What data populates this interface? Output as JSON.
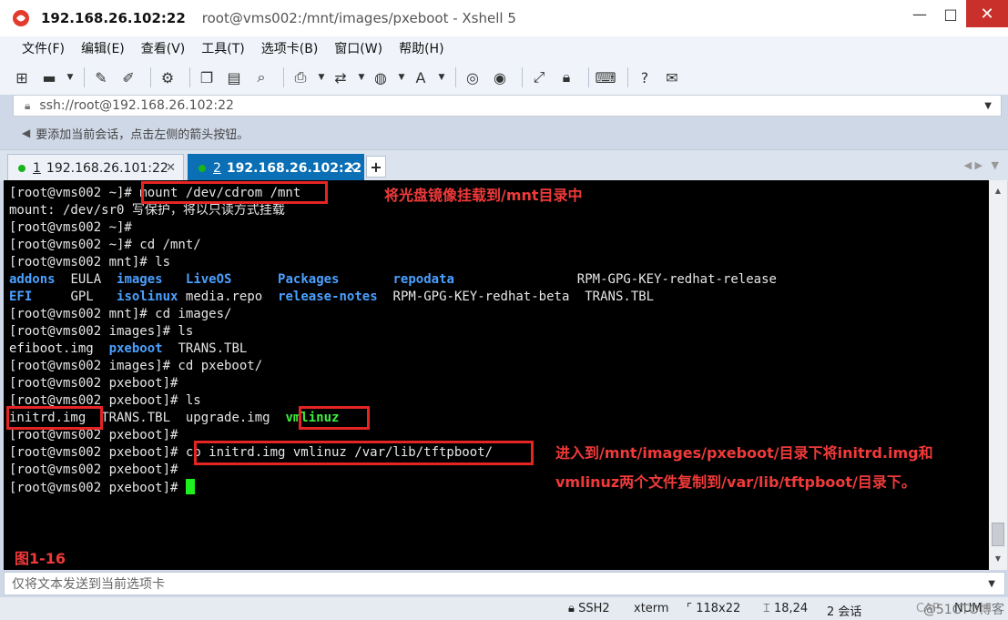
{
  "window": {
    "title_ip": "192.168.26.102:22",
    "title_path": "root@vms002:/mnt/images/pxeboot - Xshell 5",
    "minimize": "—",
    "maximize": "□",
    "close": "✕"
  },
  "menu": [
    "文件(F)",
    "编辑(E)",
    "查看(V)",
    "工具(T)",
    "选项卡(B)",
    "窗口(W)",
    "帮助(H)"
  ],
  "address": {
    "value": "ssh://root@192.168.26.102:22"
  },
  "hint": "要添加当前会话，点击左侧的箭头按钮。",
  "tabs": [
    {
      "num": "1",
      "label": "192.168.26.101:22",
      "status_color": "#18b418"
    },
    {
      "num": "2",
      "label": "192.168.26.102:22",
      "status_color": "#18b418"
    }
  ],
  "terminal": {
    "l1": "[root@vms002 ~]# mount /dev/cdrom /mnt",
    "l2": "mount: /dev/sr0 写保护，将以只读方式挂载",
    "l3": "[root@vms002 ~]#",
    "l4": "[root@vms002 ~]# cd /mnt/",
    "l5": "[root@vms002 mnt]# ls",
    "l6": [
      "addons",
      "EULA",
      "images",
      "LiveOS",
      "Packages",
      "repodata",
      "RPM-GPG-KEY-redhat-release"
    ],
    "l7": [
      "EFI",
      "GPL",
      "isolinux",
      "media.repo",
      "release-notes",
      "RPM-GPG-KEY-redhat-beta",
      "TRANS.TBL"
    ],
    "l8": "[root@vms002 mnt]# cd images/",
    "l9": "[root@vms002 images]# ls",
    "l10": [
      "efiboot.img",
      "pxeboot",
      "TRANS.TBL"
    ],
    "l11": "[root@vms002 images]# cd pxeboot/",
    "l12": "[root@vms002 pxeboot]#",
    "l13": "[root@vms002 pxeboot]# ls",
    "l14": [
      "initrd.img",
      "TRANS.TBL",
      "upgrade.img",
      "vmlinuz"
    ],
    "l15": "[root@vms002 pxeboot]#",
    "l16": "[root@vms002 pxeboot]# cp initrd.img vmlinuz /var/lib/tftpboot/",
    "l17": "[root@vms002 pxeboot]#",
    "l18": "[root@vms002 pxeboot]# "
  },
  "annotations": {
    "mount_note": "将光盘镜像挂载到/mnt目录中",
    "copy_note_1": "进入到/mnt/images/pxeboot/目录下将initrd.img和",
    "copy_note_2": "vmlinuz两个文件复制到/var/lib/tftpboot/目录下。",
    "figure": "图1-16"
  },
  "send_bar": "仅将文本发送到当前选项卡",
  "status": {
    "protocol": "SSH2",
    "term": "xterm",
    "size": "118x22",
    "pos": "18,24",
    "sessions": "2 会话",
    "caps": "CAP",
    "num": "NUM"
  },
  "watermark": "@51CTO博客",
  "colors": {
    "terminal_bg": "#000000",
    "dir_blue": "#4aa0ff",
    "exec_green": "#3df03d",
    "annotation_red": "#e52424",
    "active_tab": "#0b6fb5"
  }
}
